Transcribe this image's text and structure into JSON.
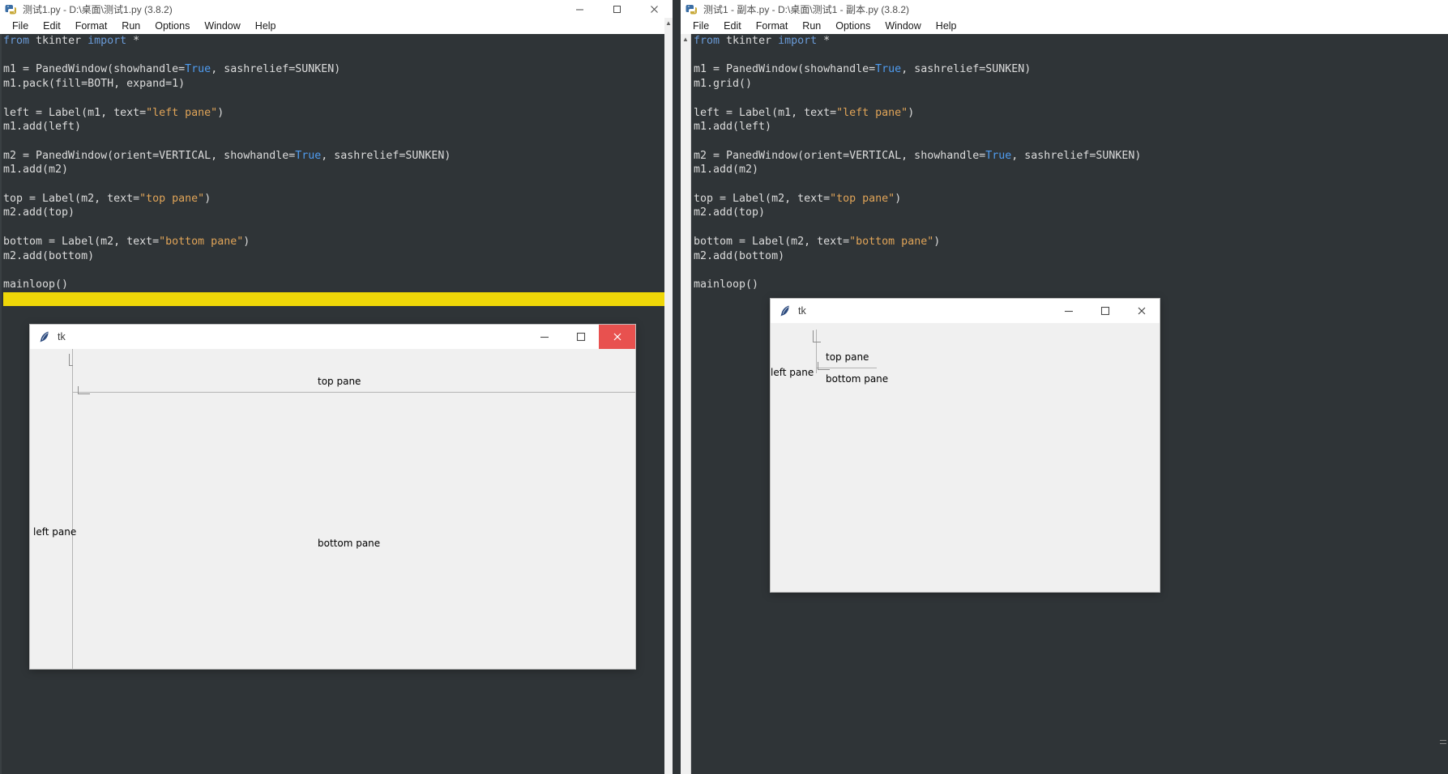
{
  "windows": {
    "left": {
      "title": "测试1.py - D:\\桌面\\测试1.py (3.8.2)",
      "menus": [
        "File",
        "Edit",
        "Format",
        "Run",
        "Options",
        "Window",
        "Help"
      ],
      "minimize_label": "Minimize",
      "maximize_label": "Maximize",
      "close_label": "Close",
      "code_lines": [
        {
          "segments": [
            {
              "t": "from",
              "c": "kw"
            },
            {
              "t": " tkinter ",
              "c": ""
            },
            {
              "t": "import",
              "c": "kw"
            },
            {
              "t": " *",
              "c": ""
            }
          ]
        },
        {
          "segments": []
        },
        {
          "segments": [
            {
              "t": "m1 = PanedWindow(showhandle=",
              "c": ""
            },
            {
              "t": "True",
              "c": "blue"
            },
            {
              "t": ", sashrelief=SUNKEN)",
              "c": ""
            }
          ]
        },
        {
          "segments": [
            {
              "t": "m1.pack(fill=BOTH, expand=1)",
              "c": ""
            }
          ]
        },
        {
          "segments": []
        },
        {
          "segments": [
            {
              "t": "left = Label(m1, text=",
              "c": ""
            },
            {
              "t": "\"left pane\"",
              "c": "str"
            },
            {
              "t": ")",
              "c": ""
            }
          ]
        },
        {
          "segments": [
            {
              "t": "m1.add(left)",
              "c": ""
            }
          ]
        },
        {
          "segments": []
        },
        {
          "segments": [
            {
              "t": "m2 = PanedWindow(orient=VERTICAL, showhandle=",
              "c": ""
            },
            {
              "t": "True",
              "c": "blue"
            },
            {
              "t": ", sashrelief=SUNKEN)",
              "c": ""
            }
          ]
        },
        {
          "segments": [
            {
              "t": "m1.add(m2)",
              "c": ""
            }
          ]
        },
        {
          "segments": []
        },
        {
          "segments": [
            {
              "t": "top = Label(m2, text=",
              "c": ""
            },
            {
              "t": "\"top pane\"",
              "c": "str"
            },
            {
              "t": ")",
              "c": ""
            }
          ]
        },
        {
          "segments": [
            {
              "t": "m2.add(top)",
              "c": ""
            }
          ]
        },
        {
          "segments": []
        },
        {
          "segments": [
            {
              "t": "bottom = Label(m2, text=",
              "c": ""
            },
            {
              "t": "\"bottom pane\"",
              "c": "str"
            },
            {
              "t": ")",
              "c": ""
            }
          ]
        },
        {
          "segments": [
            {
              "t": "m2.add(bottom)",
              "c": ""
            }
          ]
        },
        {
          "segments": []
        },
        {
          "segments": [
            {
              "t": "mainloop()",
              "c": ""
            }
          ]
        },
        {
          "segments": [],
          "highlight": true
        }
      ]
    },
    "right": {
      "title": "测试1 - 副本.py - D:\\桌面\\测试1 - 副本.py (3.8.2)",
      "menus": [
        "File",
        "Edit",
        "Format",
        "Run",
        "Options",
        "Window",
        "Help"
      ],
      "minimize_label": "Minimize",
      "maximize_label": "Maximize",
      "close_label": "Close",
      "code_lines": [
        {
          "segments": [
            {
              "t": "from",
              "c": "kw"
            },
            {
              "t": " tkinter ",
              "c": ""
            },
            {
              "t": "import",
              "c": "kw"
            },
            {
              "t": " *",
              "c": ""
            }
          ]
        },
        {
          "segments": []
        },
        {
          "segments": [
            {
              "t": "m1 = PanedWindow(showhandle=",
              "c": ""
            },
            {
              "t": "True",
              "c": "blue"
            },
            {
              "t": ", sashrelief=SUNKEN)",
              "c": ""
            }
          ]
        },
        {
          "segments": [
            {
              "t": "m1.grid()",
              "c": ""
            }
          ]
        },
        {
          "segments": []
        },
        {
          "segments": [
            {
              "t": "left = Label(m1, text=",
              "c": ""
            },
            {
              "t": "\"left pane\"",
              "c": "str"
            },
            {
              "t": ")",
              "c": ""
            }
          ]
        },
        {
          "segments": [
            {
              "t": "m1.add(left)",
              "c": ""
            }
          ]
        },
        {
          "segments": []
        },
        {
          "segments": [
            {
              "t": "m2 = PanedWindow(orient=VERTICAL, showhandle=",
              "c": ""
            },
            {
              "t": "True",
              "c": "blue"
            },
            {
              "t": ", sashrelief=SUNKEN)",
              "c": ""
            }
          ]
        },
        {
          "segments": [
            {
              "t": "m1.add(m2)",
              "c": ""
            }
          ]
        },
        {
          "segments": []
        },
        {
          "segments": [
            {
              "t": "top = Label(m2, text=",
              "c": ""
            },
            {
              "t": "\"top pane\"",
              "c": "str"
            },
            {
              "t": ")",
              "c": ""
            }
          ]
        },
        {
          "segments": [
            {
              "t": "m2.add(top)",
              "c": ""
            }
          ]
        },
        {
          "segments": []
        },
        {
          "segments": [
            {
              "t": "bottom = Label(m2, text=",
              "c": ""
            },
            {
              "t": "\"bottom pane\"",
              "c": "str"
            },
            {
              "t": ")",
              "c": ""
            }
          ]
        },
        {
          "segments": [
            {
              "t": "m2.add(bottom)",
              "c": ""
            }
          ]
        },
        {
          "segments": []
        },
        {
          "segments": [
            {
              "t": "mainloop()",
              "c": ""
            }
          ]
        }
      ]
    }
  },
  "tk_windows": {
    "left": {
      "title": "tk",
      "minimize_label": "Minimize",
      "maximize_label": "Maximize",
      "close_label": "Close",
      "panes": {
        "left_pane": "left pane",
        "top_pane": "top pane",
        "bottom_pane": "bottom pane"
      }
    },
    "right": {
      "title": "tk",
      "minimize_label": "Minimize",
      "maximize_label": "Maximize",
      "close_label": "Close",
      "panes": {
        "left_pane": "left pane",
        "top_pane": "top pane",
        "bottom_pane": "bottom pane"
      }
    }
  },
  "colors": {
    "editor_bg": "#2f3437",
    "keyword": "#6a9bd8",
    "string": "#e0a458",
    "builtin": "#4f9cf0",
    "highlight": "#efd708",
    "close_red": "#e8514f"
  }
}
